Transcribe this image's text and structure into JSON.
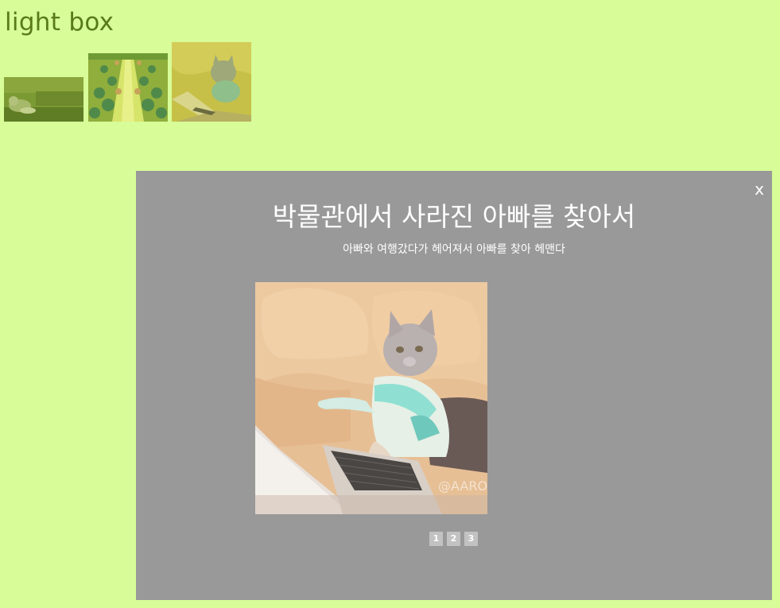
{
  "page": {
    "title": "light box"
  },
  "thumbnails": [
    {
      "name": "dog-thumbnail"
    },
    {
      "name": "crowd-thumbnail"
    },
    {
      "name": "cat-laptop-thumbnail"
    }
  ],
  "lightbox": {
    "close_label": "x",
    "title": "박물관에서 사라진 아빠를 찾아서",
    "subtitle": "아빠와 여행갔다가 헤어져서 아빠를 찾아 헤맨다",
    "image_watermark": "@AARON",
    "pages": [
      "1",
      "2",
      "3"
    ]
  },
  "colors": {
    "background": "#d7fc98",
    "title_text": "#5a7a1a",
    "overlay": "#999999",
    "pager_button": "#c2c2c2"
  }
}
